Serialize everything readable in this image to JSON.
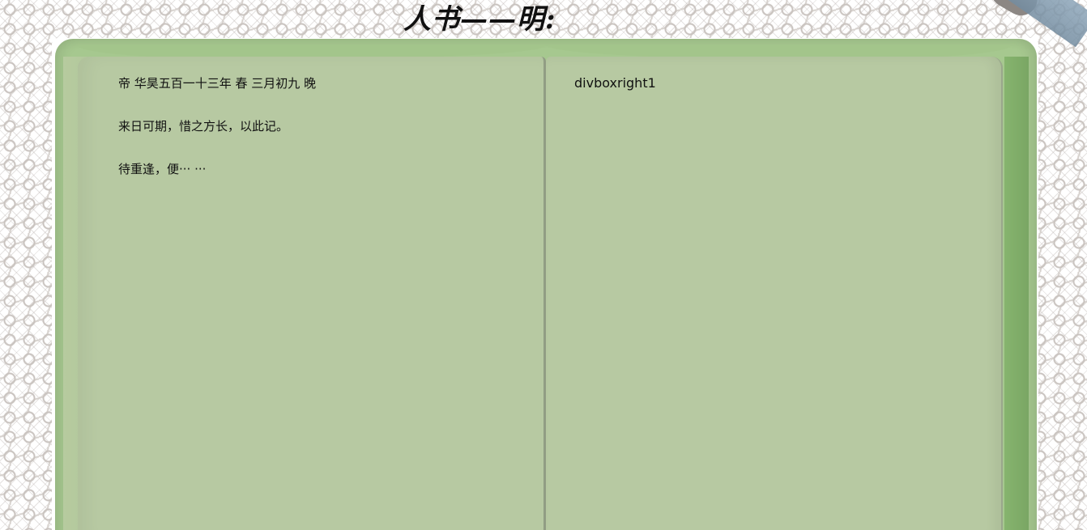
{
  "header": {
    "title": "人书——明:"
  },
  "book": {
    "left_page": {
      "lines": [
        "帝 华昊五百一十三年 春 三月初九 晚",
        "来日可期，惜之方长，以此记。",
        "待重逢，便··· ···"
      ]
    },
    "right_page": {
      "text": "divboxright1"
    }
  },
  "colors": {
    "book_cover": "#a6c88f",
    "page": "#b7c9a2",
    "page_spine": "#919d84",
    "text": "#111111"
  }
}
